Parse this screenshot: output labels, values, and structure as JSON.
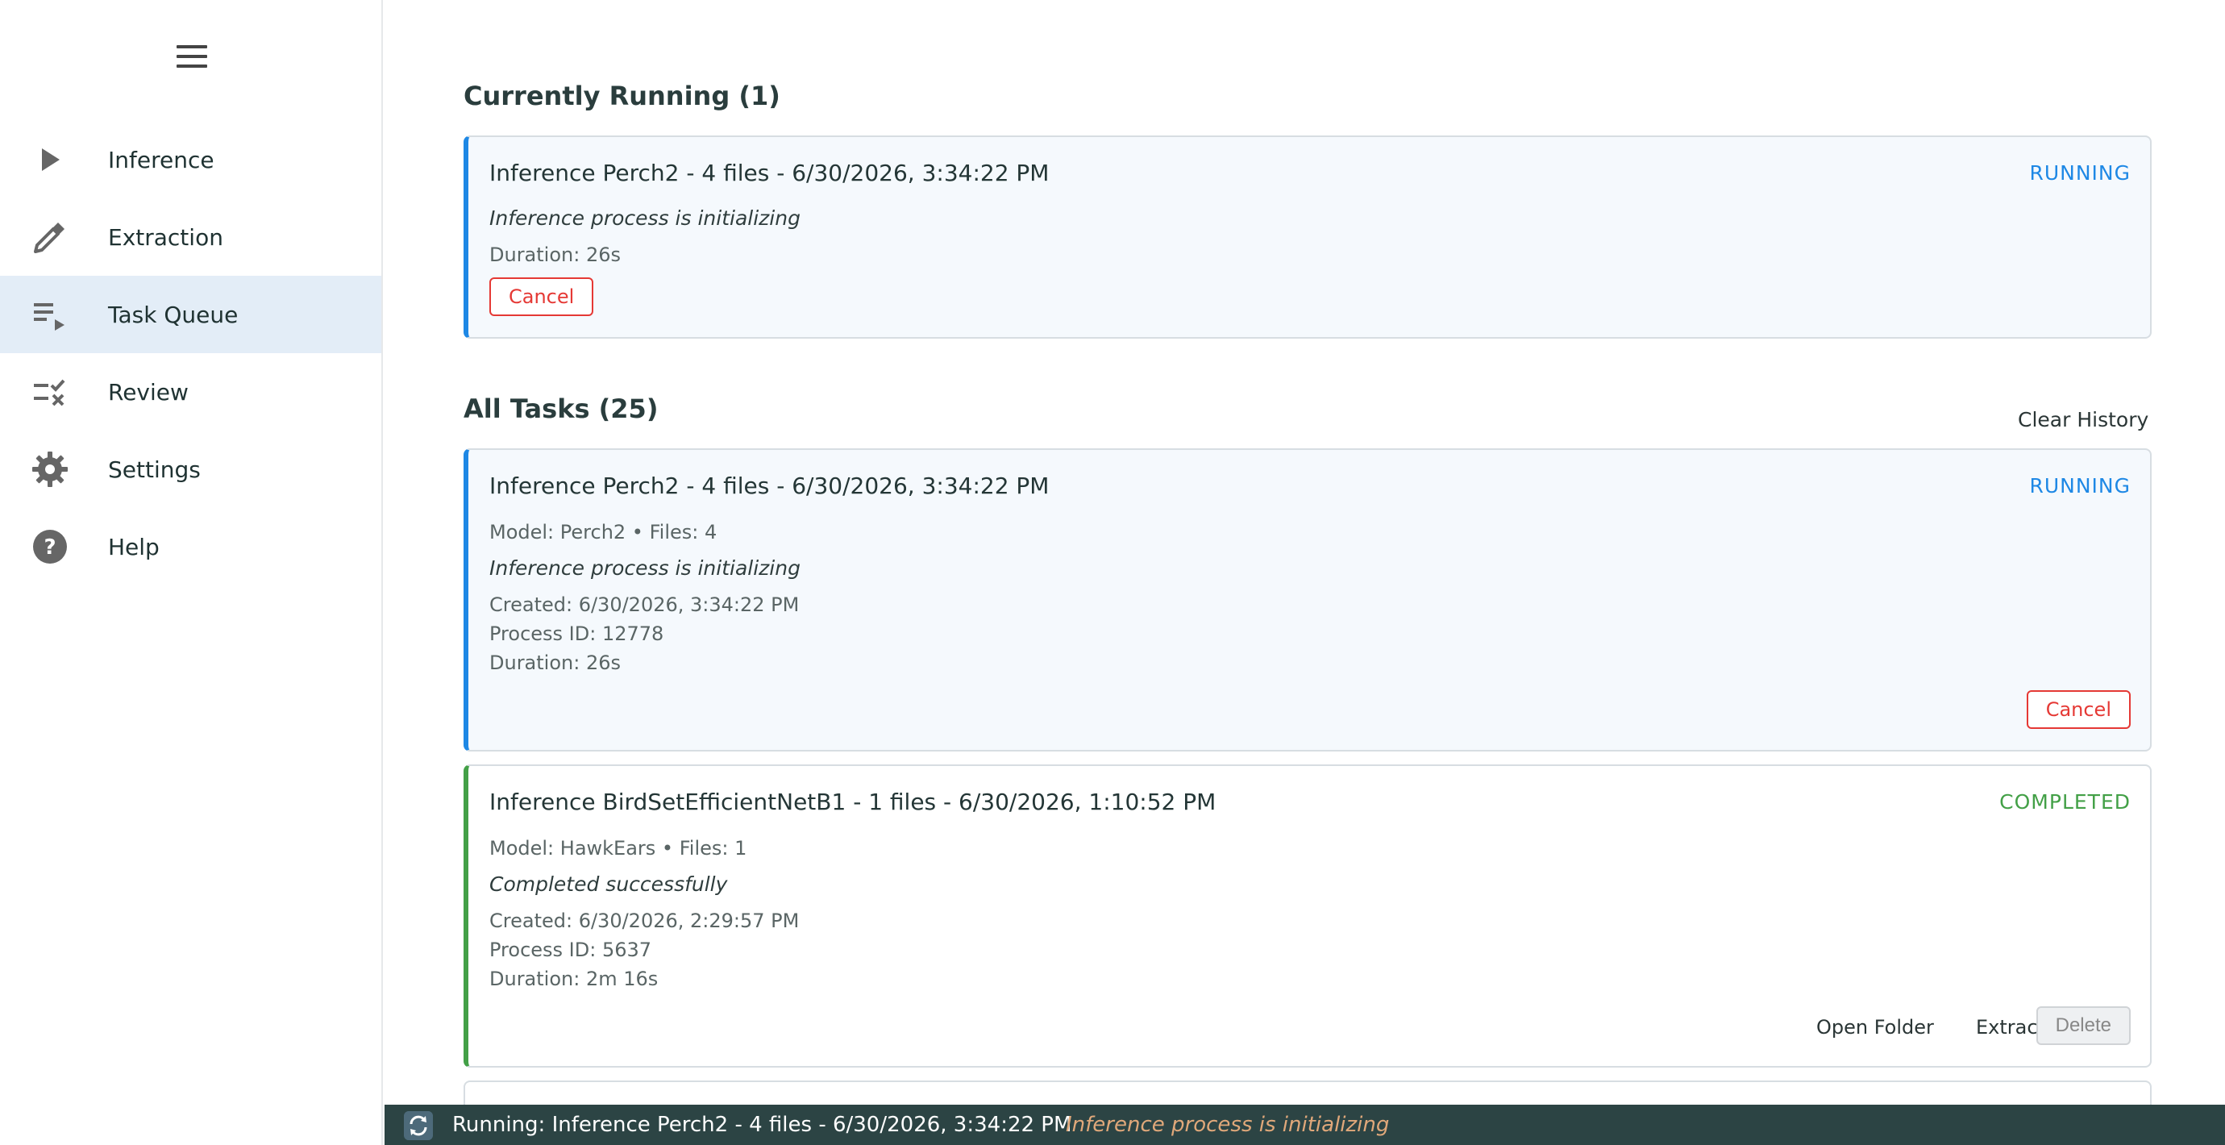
{
  "sidebar": {
    "items": [
      {
        "label": "Inference",
        "icon": "play-icon",
        "active": false
      },
      {
        "label": "Extraction",
        "icon": "pipette-icon",
        "active": false
      },
      {
        "label": "Task Queue",
        "icon": "queue-play-icon",
        "active": true
      },
      {
        "label": "Review",
        "icon": "review-check-icon",
        "active": false
      },
      {
        "label": "Settings",
        "icon": "gear-icon",
        "active": false
      },
      {
        "label": "Help",
        "icon": "help-icon",
        "active": false
      }
    ]
  },
  "running_section": {
    "title": "Currently Running (1)",
    "card": {
      "title": "Inference Perch2 - 4 files - 6/30/2026, 3:34:22 PM",
      "status": "RUNNING",
      "message": "Inference process is initializing",
      "duration": "Duration: 26s",
      "cancel_label": "Cancel"
    }
  },
  "all_section": {
    "title": "All Tasks (25)",
    "clear_label": "Clear History",
    "tasks": [
      {
        "title": "Inference Perch2 - 4 files - 6/30/2026, 3:34:22 PM",
        "status": "RUNNING",
        "model": "Model: Perch2 • Files: 4",
        "message": "Inference process is initializing",
        "created": "Created: 6/30/2026, 3:34:22 PM",
        "pid": "Process ID: 12778",
        "duration": "Duration: 26s",
        "cancel_label": "Cancel"
      },
      {
        "title": "Inference BirdSetEfficientNetB1 - 1 files - 6/30/2026, 1:10:52 PM",
        "status": "COMPLETED",
        "model": "Model: HawkEars • Files: 1",
        "message": "Completed successfully",
        "created": "Created: 6/30/2026, 2:29:57 PM",
        "pid": "Process ID: 5637",
        "duration": "Duration: 2m 16s",
        "open_folder_label": "Open Folder",
        "extract_clips_label": "Extract Clips",
        "delete_label": "Delete"
      }
    ]
  },
  "statusbar": {
    "text": "Running: Inference Perch2 - 4 files - 6/30/2026, 3:34:22 PM",
    "message": "Inference process is initializing",
    "icon": "sync-icon"
  },
  "colors": {
    "running": "#1e88e5",
    "completed": "#43a047",
    "cancel": "#e53935",
    "statusbar_bg": "#2c4444",
    "active_nav_bg": "#e3edf7"
  }
}
